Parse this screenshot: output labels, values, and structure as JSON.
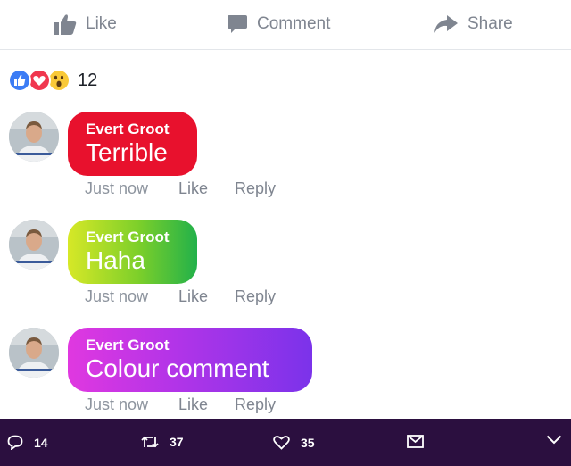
{
  "actions": {
    "like_label": "Like",
    "comment_label": "Comment",
    "share_label": "Share"
  },
  "reactions": {
    "types": [
      "like",
      "love",
      "wow"
    ],
    "count": "12"
  },
  "comments": [
    {
      "author": "Evert Groot",
      "text": "Terrible",
      "bubble_color": "#e8112d",
      "time": "Just now",
      "like_label": "Like",
      "reply_label": "Reply"
    },
    {
      "author": "Evert Groot",
      "text": "Haha",
      "bubble_color": "#7ccf2a",
      "time": "Just now",
      "like_label": "Like",
      "reply_label": "Reply"
    },
    {
      "author": "Evert Groot",
      "text": "Colour comment",
      "bubble_color": "#b134e8",
      "time": "Just now",
      "like_label": "Like",
      "reply_label": "Reply"
    }
  ],
  "tweet_bar": {
    "background": "#2b0f3f",
    "replies": "14",
    "retweets": "37",
    "likes": "35",
    "icons": [
      "reply-icon",
      "retweet-icon",
      "heart-icon",
      "mail-icon",
      "chevron-down-icon"
    ]
  }
}
